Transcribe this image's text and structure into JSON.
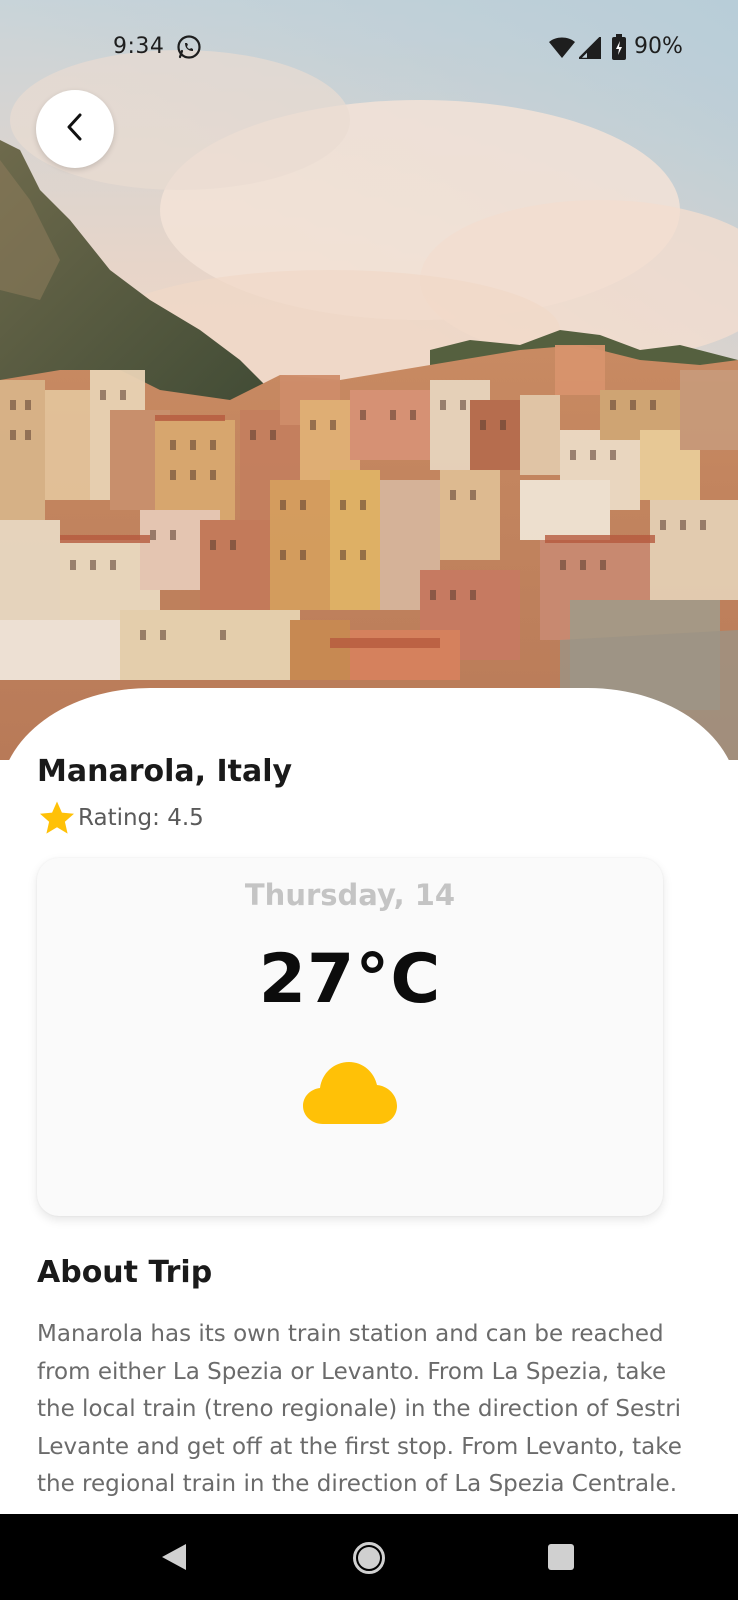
{
  "status_bar": {
    "time": "9:34",
    "battery": "90%",
    "icons": [
      "whatsapp-icon",
      "wifi-icon",
      "cell-signal-icon",
      "battery-charging-icon"
    ]
  },
  "header": {
    "back_icon": "chevron-left-icon",
    "hero_image": "hillside-village-photo"
  },
  "place": {
    "title": "Manarola, Italy",
    "rating_label": "Rating: 4.5",
    "rating_icon": "star-icon",
    "star_color": "#FFC107"
  },
  "weather": {
    "day": "Thursday, 14",
    "temperature": "27°C",
    "icon": "cloud-icon",
    "icon_color": "#FFC107"
  },
  "about": {
    "heading": "About Trip",
    "body": "Manarola has its own train station and can be reached from either La Spezia or Levanto. From La Spezia, take the local train (treno regionale) in the direction of Sestri Levante and get off at the first stop. From Levanto, take the regional train in the direction of La Spezia Centrale."
  },
  "nav_bar": {
    "icons": [
      "nav-back-icon",
      "nav-home-icon",
      "nav-recents-icon"
    ]
  }
}
